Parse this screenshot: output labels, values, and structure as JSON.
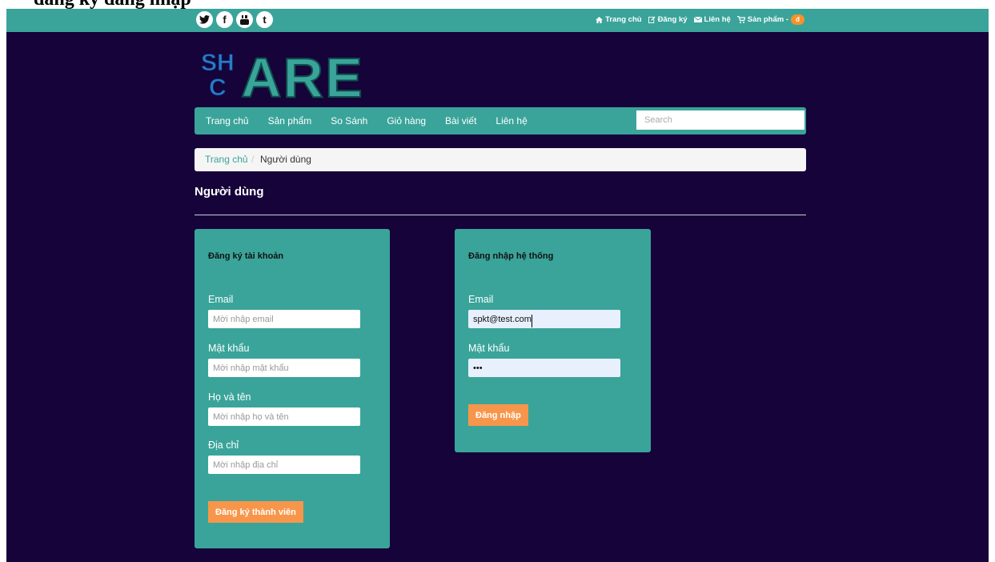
{
  "document": {
    "heading": "đăng ký đăng nhập"
  },
  "topbar": {
    "social": [
      "twitter-icon",
      "facebook-icon",
      "youtube-icon",
      "tumblr-icon"
    ],
    "links": [
      {
        "icon": "home-icon",
        "label": "Trang chủ"
      },
      {
        "icon": "edit-icon",
        "label": "Đăng ký"
      },
      {
        "icon": "mail-icon",
        "label": "Liên hệ"
      },
      {
        "icon": "cart-icon",
        "label": "Sản phẩm -"
      }
    ],
    "cart_badge": "đ"
  },
  "logo": {
    "left": "SH",
    "left2": "C",
    "right": "ARE"
  },
  "nav": {
    "items": [
      "Trang chủ",
      "Sản phẩm",
      "So Sánh",
      "Giỏ hàng",
      "Bài viết",
      "Liên hệ"
    ],
    "search_placeholder": "Search"
  },
  "breadcrumb": {
    "home": "Trang chủ",
    "separator": "/",
    "current": "Người dùng"
  },
  "page_title": "Người dùng",
  "register": {
    "title": "Đăng ký tài khoản",
    "email_label": "Email",
    "email_placeholder": "Mời nhập email",
    "password_label": "Mật khẩu",
    "password_placeholder": "Mời nhập mật khẩu",
    "name_label": "Họ và tên",
    "name_placeholder": "Mời nhập họ và tên",
    "address_label": "Địa chỉ",
    "address_placeholder": "Mời nhập địa chỉ",
    "submit": "Đăng ký thành viên"
  },
  "login": {
    "title": "Đăng nhập hệ thống",
    "email_label": "Email",
    "email_value": "spkt@test.com",
    "password_label": "Mật khẩu",
    "password_value": "•••",
    "submit": "Đăng nhập"
  },
  "colors": {
    "teal": "#3aa49a",
    "background": "#15033a",
    "orange": "#f7964a"
  }
}
